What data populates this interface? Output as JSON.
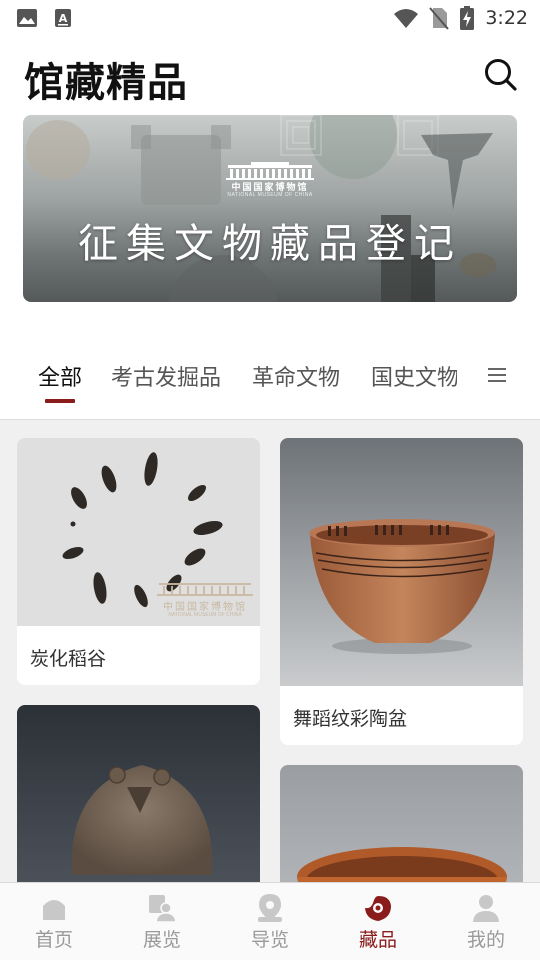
{
  "status_bar": {
    "time": "3:22",
    "icons": [
      "image-icon",
      "text-a-icon",
      "wifi-icon",
      "no-sim-icon",
      "battery-charging-icon"
    ]
  },
  "header": {
    "title": "馆藏精品",
    "search_icon": "search-icon"
  },
  "banner": {
    "logo_cn": "中国国家博物馆",
    "logo_en": "NATIONAL MUSEUM OF CHINA",
    "title": "征集文物藏品登记"
  },
  "tabs": {
    "items": [
      {
        "label": "全部",
        "active": true
      },
      {
        "label": "考古发掘品",
        "active": false
      },
      {
        "label": "革命文物",
        "active": false
      },
      {
        "label": "国史文物",
        "active": false
      }
    ],
    "menu_icon": "menu-icon",
    "active_color": "#8b1c1c"
  },
  "collection": {
    "items": [
      {
        "name": "炭化稻谷"
      },
      {
        "name": "舞蹈纹彩陶盆"
      },
      {
        "name": ""
      },
      {
        "name": ""
      }
    ],
    "watermark_cn": "中国国家博物馆",
    "watermark_en": "NATIONAL MUSEUM OF CHINA"
  },
  "bottom_nav": {
    "items": [
      {
        "label": "首页",
        "icon": "home-icon",
        "active": false
      },
      {
        "label": "展览",
        "icon": "exhibition-icon",
        "active": false
      },
      {
        "label": "导览",
        "icon": "location-pin-icon",
        "active": false
      },
      {
        "label": "藏品",
        "icon": "collection-icon",
        "active": true
      },
      {
        "label": "我的",
        "icon": "profile-icon",
        "active": false
      }
    ],
    "active_color": "#8b1c1c",
    "inactive_color": "#c8c8c8"
  }
}
